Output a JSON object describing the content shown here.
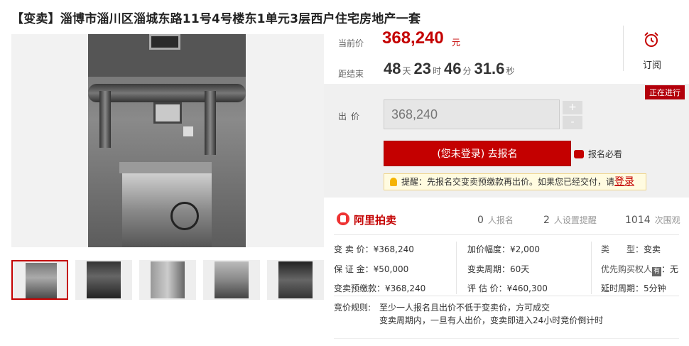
{
  "title": "【变卖】淄博市淄川区淄城东路11号4号楼东1单元3层西户住宅房地产一套",
  "price": {
    "current_label": "当前价",
    "current_value": "368,240",
    "unit": "元"
  },
  "countdown": {
    "label": "距结束",
    "days": "48",
    "days_unit": "天",
    "hours": "23",
    "hours_unit": "时",
    "minutes": "46",
    "minutes_unit": "分",
    "seconds": "31.6",
    "seconds_unit": "秒"
  },
  "subscribe": {
    "label": "订阅",
    "icon": "alarm-clock-icon"
  },
  "bid": {
    "status": "正在进行",
    "label": "出价",
    "input_value": "368,240",
    "plus": "+",
    "minus": "-",
    "signup_button": "(您未登录) 去报名",
    "must_read": "报名必看",
    "tip_text": "提醒：先报名交变卖预缴款再出价。如果您已经交付，请",
    "tip_login": "登录"
  },
  "stats": {
    "brand": "阿里拍卖",
    "signups_count": "0",
    "signups_label": "人报名",
    "reminders_count": "2",
    "reminders_label": "人设置提醒",
    "views_count": "1014",
    "views_label": "次围观"
  },
  "info": {
    "sale_price": "变 卖 价：¥368,240",
    "deposit": "保 证 金：¥50,000",
    "prepayment": "变卖预缴款：¥368,240",
    "increment": "加价幅度：¥2,000",
    "sale_period": "变卖周期：60天",
    "appraisal": "评 估 价：¥460,300",
    "type_key": "类　　型：",
    "type_value": "变卖",
    "priority_key": "优先购买权人",
    "priority_badge": "有",
    "priority_value": "：无",
    "extension": "延时周期：5分钟"
  },
  "rules": {
    "label": "竞价规则:",
    "line1": "至少一人报名且出价不低于变卖价，方可成交",
    "line2": "变卖周期内，一旦有人出价，变卖即进入24小时竞价倒计时"
  },
  "colors": {
    "accent": "#c40000",
    "status_badge": "#b3000b",
    "panel_bg": "#f0f0f0"
  }
}
